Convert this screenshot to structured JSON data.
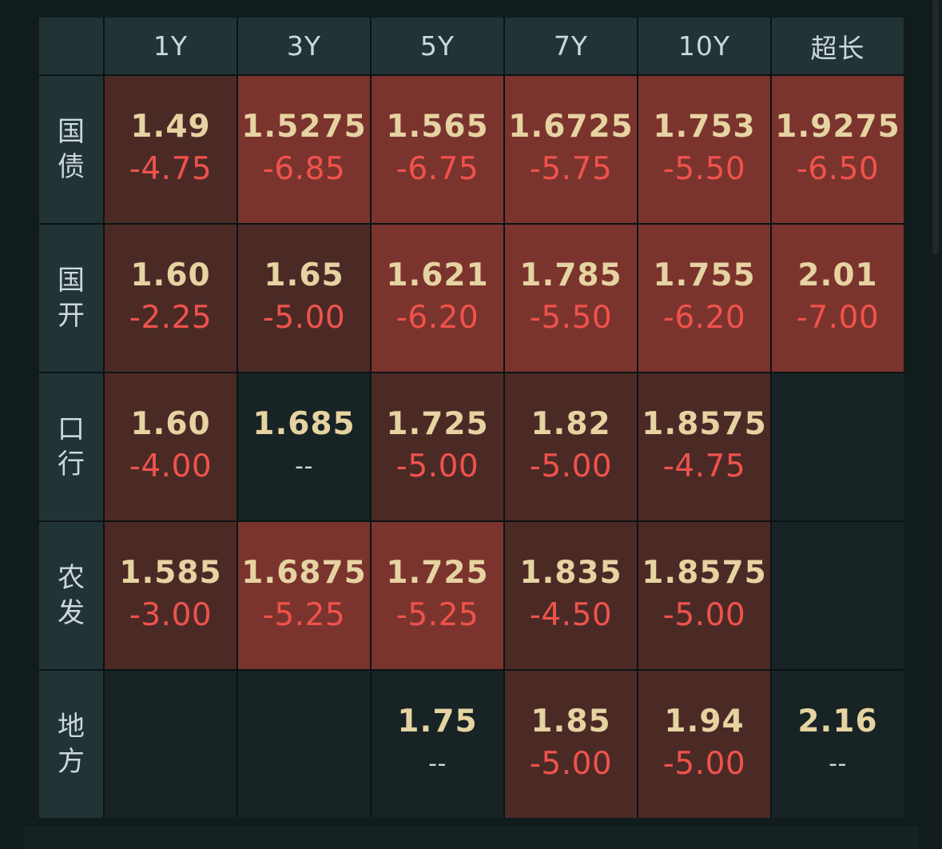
{
  "columns": [
    "1Y",
    "3Y",
    "5Y",
    "7Y",
    "10Y",
    "超长"
  ],
  "rows": [
    {
      "label": "国债",
      "cells": [
        {
          "yield": "1.49",
          "change": "-4.75",
          "heat": 1
        },
        {
          "yield": "1.5275",
          "change": "-6.85",
          "heat": 3
        },
        {
          "yield": "1.565",
          "change": "-6.75",
          "heat": 3
        },
        {
          "yield": "1.6725",
          "change": "-5.75",
          "heat": 3
        },
        {
          "yield": "1.753",
          "change": "-5.50",
          "heat": 3
        },
        {
          "yield": "1.9275",
          "change": "-6.50",
          "heat": 3
        }
      ]
    },
    {
      "label": "国开",
      "cells": [
        {
          "yield": "1.60",
          "change": "-2.25",
          "heat": 1
        },
        {
          "yield": "1.65",
          "change": "-5.00",
          "heat": 1
        },
        {
          "yield": "1.621",
          "change": "-6.20",
          "heat": 3
        },
        {
          "yield": "1.785",
          "change": "-5.50",
          "heat": 3
        },
        {
          "yield": "1.755",
          "change": "-6.20",
          "heat": 3
        },
        {
          "yield": "2.01",
          "change": "-7.00",
          "heat": 3
        }
      ]
    },
    {
      "label": "口行",
      "cells": [
        {
          "yield": "1.60",
          "change": "-4.00",
          "heat": 1
        },
        {
          "yield": "1.685",
          "change": "--",
          "heat": 0
        },
        {
          "yield": "1.725",
          "change": "-5.00",
          "heat": 1
        },
        {
          "yield": "1.82",
          "change": "-5.00",
          "heat": 1
        },
        {
          "yield": "1.8575",
          "change": "-4.75",
          "heat": 1
        },
        {
          "yield": "",
          "change": "",
          "heat": 0
        }
      ]
    },
    {
      "label": "农发",
      "cells": [
        {
          "yield": "1.585",
          "change": "-3.00",
          "heat": 1
        },
        {
          "yield": "1.6875",
          "change": "-5.25",
          "heat": 3
        },
        {
          "yield": "1.725",
          "change": "-5.25",
          "heat": 3
        },
        {
          "yield": "1.835",
          "change": "-4.50",
          "heat": 1
        },
        {
          "yield": "1.8575",
          "change": "-5.00",
          "heat": 1
        },
        {
          "yield": "",
          "change": "",
          "heat": 0
        }
      ]
    },
    {
      "label": "地方",
      "cells": [
        {
          "yield": "",
          "change": "",
          "heat": 0
        },
        {
          "yield": "",
          "change": "",
          "heat": 0
        },
        {
          "yield": "1.75",
          "change": "--",
          "heat": 0
        },
        {
          "yield": "1.85",
          "change": "-5.00",
          "heat": 1
        },
        {
          "yield": "1.94",
          "change": "-5.00",
          "heat": 1
        },
        {
          "yield": "2.16",
          "change": "--",
          "heat": 0
        }
      ]
    }
  ],
  "colors": {
    "yield_text": "#e6d3a2",
    "change_text": "#f0524c",
    "header_bg": "#223336",
    "heat_low": "#4b2a26",
    "heat_high": "#7a342d"
  }
}
